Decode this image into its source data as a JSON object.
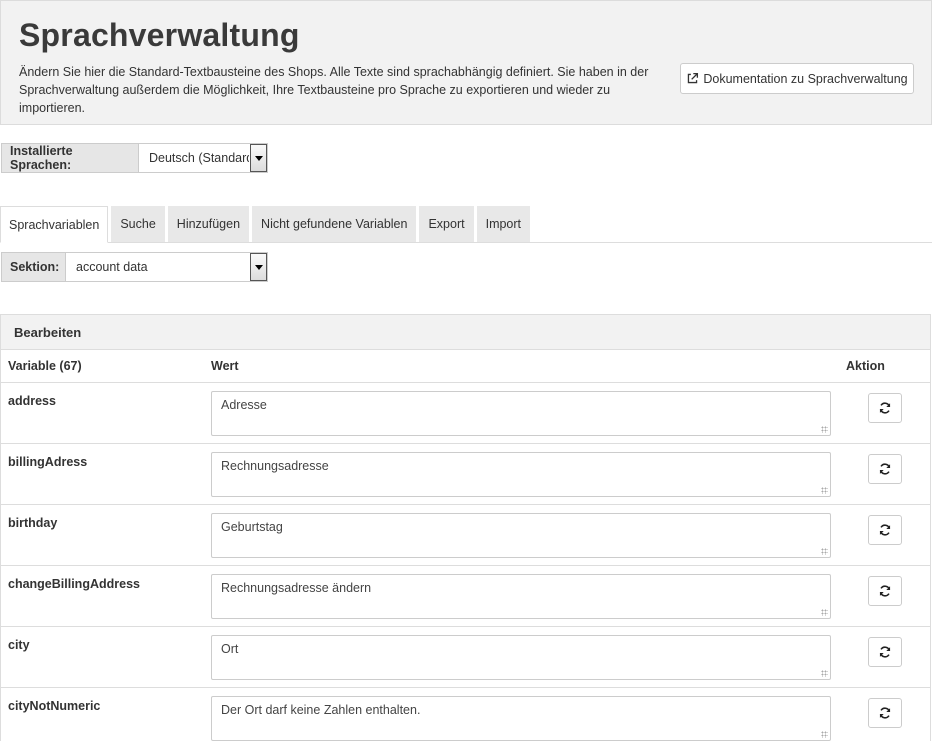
{
  "header": {
    "title": "Sprachverwaltung",
    "description": "Ändern Sie hier die Standard-Textbausteine des Shops. Alle Texte sind sprachabhängig definiert. Sie haben in der Sprachverwaltung außerdem die Möglichkeit, Ihre Textbausteine pro Sprache zu exportieren und wieder zu importieren.",
    "doc_button": "Dokumentation zu Sprachverwaltung",
    "doc_icon": "external-link-icon"
  },
  "language": {
    "label": "Installierte Sprachen:",
    "selected": "Deutsch (Standard)"
  },
  "tabs": [
    {
      "label": "Sprachvariablen",
      "active": true
    },
    {
      "label": "Suche"
    },
    {
      "label": "Hinzufügen"
    },
    {
      "label": "Nicht gefundene Variablen"
    },
    {
      "label": "Export"
    },
    {
      "label": "Import"
    }
  ],
  "section": {
    "label": "Sektion:",
    "selected": "account data"
  },
  "panel": {
    "title": "Bearbeiten",
    "columns": {
      "variable": "Variable (67)",
      "value": "Wert",
      "action": "Aktion"
    },
    "action_icon": "refresh-icon",
    "rows": [
      {
        "variable": "address",
        "value": "Adresse"
      },
      {
        "variable": "billingAdress",
        "value": "Rechnungsadresse"
      },
      {
        "variable": "birthday",
        "value": "Geburtstag"
      },
      {
        "variable": "changeBillingAddress",
        "value": "Rechnungsadresse ändern"
      },
      {
        "variable": "city",
        "value": "Ort"
      },
      {
        "variable": "cityNotNumeric",
        "value": "Der Ort darf keine Zahlen enthalten."
      }
    ]
  }
}
